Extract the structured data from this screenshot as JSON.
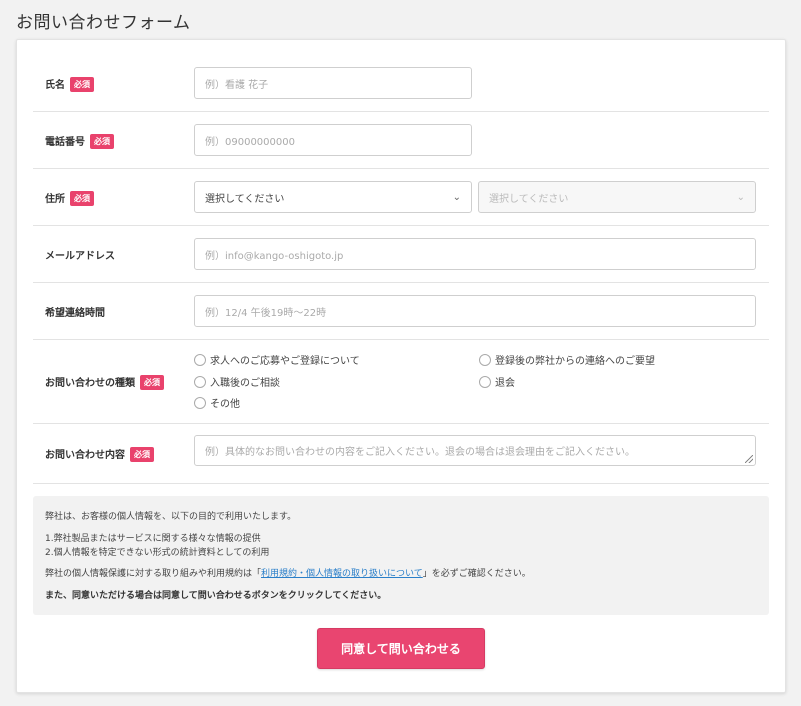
{
  "page": {
    "title": "お問い合わせフォーム"
  },
  "required_badge": "必須",
  "form": {
    "name": {
      "label": "氏名",
      "placeholder": "例）看護 花子"
    },
    "phone": {
      "label": "電話番号",
      "placeholder": "例）09000000000"
    },
    "address": {
      "label": "住所",
      "prefecture_value": "選択してください",
      "city_value": "選択してください"
    },
    "email": {
      "label": "メールアドレス",
      "placeholder": "例）info@kango-oshigoto.jp"
    },
    "contact_time": {
      "label": "希望連絡時間",
      "placeholder": "例）12/4 午後19時～22時"
    },
    "inquiry_type": {
      "label": "お問い合わせの種類",
      "options": [
        "求人へのご応募やご登録について",
        "登録後の弊社からの連絡へのご要望",
        "入職後のご相談",
        "退会",
        "その他"
      ]
    },
    "inquiry_content": {
      "label": "お問い合わせ内容",
      "placeholder": "例）具体的なお問い合わせの内容をご記入ください。退会の場合は退会理由をご記入ください。"
    }
  },
  "privacy": {
    "intro": "弊社は、お客様の個人情報を、以下の目的で利用いたします。",
    "purpose_1": "1.弊社製品またはサービスに関する様々な情報の提供",
    "purpose_2": "2.個人情報を特定できない形式の統計資料としての利用",
    "confirm_prefix": "弊社の個人情報保護に対する取り組みや利用規約は「",
    "confirm_link": "利用規約・個人情報の取り扱いについて",
    "confirm_suffix": "」を必ずご確認ください。",
    "agree_note": "また、同意いただける場合は同意して問い合わせるボタンをクリックしてください。"
  },
  "submit_label": "同意して問い合わせる",
  "colors": {
    "accent": "#e94570",
    "link": "#2a7fc9"
  }
}
